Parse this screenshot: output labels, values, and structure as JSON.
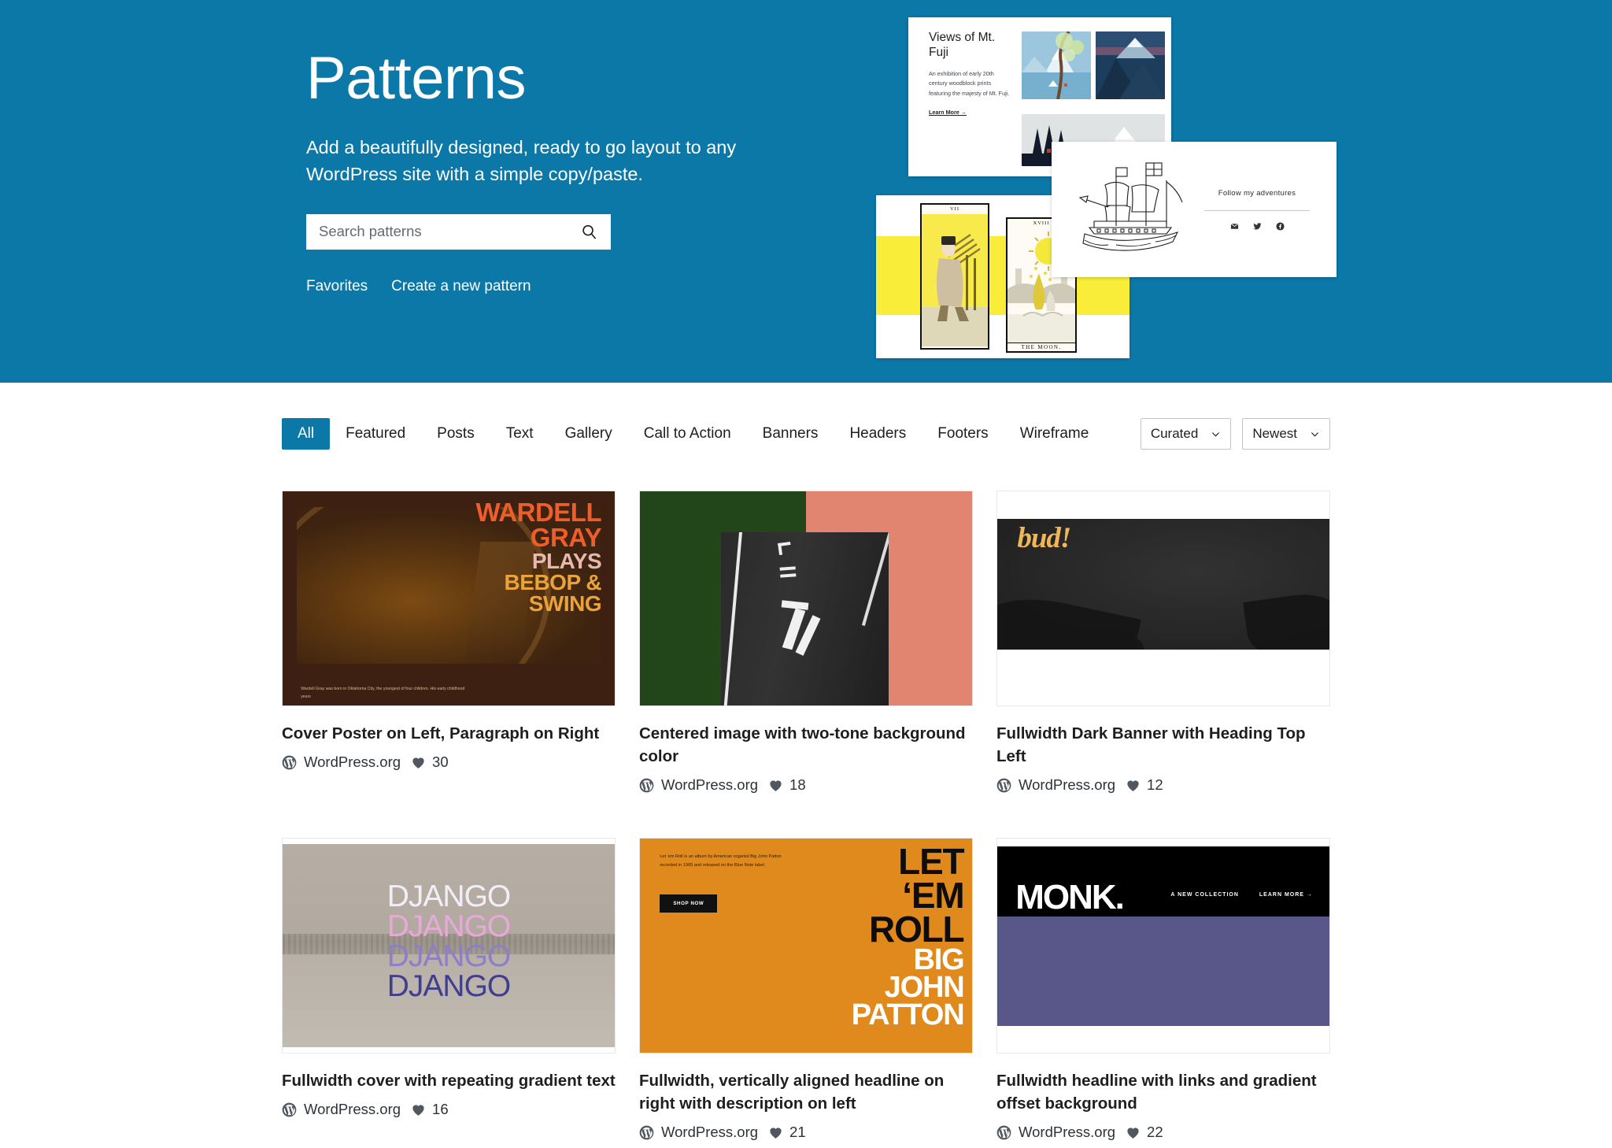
{
  "hero": {
    "title": "Patterns",
    "subtitle": "Add a beautifully designed, ready to go layout to any WordPress site with a simple copy/paste.",
    "search": {
      "value": "",
      "placeholder": "Search patterns",
      "icon": "search-icon",
      "button_label": "Search"
    },
    "links": [
      {
        "label": "Favorites"
      },
      {
        "label": "Create a new pattern"
      }
    ],
    "background_color": "#0b78a8",
    "mockups": {
      "fuji": {
        "heading": "Views of Mt. Fuji",
        "body": "An exhibition of early 20th century woodblock prints featuring the majesty of Mt. Fuji.",
        "link": "Learn More →"
      },
      "tarot": {
        "card_one_numeral": "VII",
        "card_two_numeral": "XVIII",
        "card_two_name": "THE MOON."
      },
      "ship": {
        "heading": "Follow my adventures",
        "icons": [
          "mail-icon",
          "twitter-icon",
          "facebook-icon"
        ]
      }
    }
  },
  "toolbar": {
    "tabs": [
      {
        "label": "All",
        "active": true
      },
      {
        "label": "Featured",
        "active": false
      },
      {
        "label": "Posts",
        "active": false
      },
      {
        "label": "Text",
        "active": false
      },
      {
        "label": "Gallery",
        "active": false
      },
      {
        "label": "Call to Action",
        "active": false
      },
      {
        "label": "Banners",
        "active": false
      },
      {
        "label": "Headers",
        "active": false
      },
      {
        "label": "Footers",
        "active": false
      },
      {
        "label": "Wireframe",
        "active": false
      }
    ],
    "selects": [
      {
        "name": "curation-select",
        "value": "Curated",
        "icon": "chevron-down-icon"
      },
      {
        "name": "sort-select",
        "value": "Newest",
        "icon": "chevron-down-icon"
      }
    ],
    "active_tab_color": "#0b78a8"
  },
  "patterns": [
    {
      "title": "Cover Poster on Left, Paragraph on Right",
      "author": "WordPress.org",
      "favorites": "30",
      "art": {
        "lines": [
          "WARDELL",
          "GRAY",
          "PLAYS",
          "BEBOP &",
          "SWING"
        ],
        "paragraph": "Wardell Gray was born in Oklahoma City, the youngest of four children. His early childhood years",
        "colors": {
          "background": "#3d2011",
          "accent": "#ef5d2a",
          "secondary": "#e8b8b0",
          "tertiary": "#e8a33c"
        }
      }
    },
    {
      "title": "Centered image with two-tone background color",
      "author": "WordPress.org",
      "favorites": "18",
      "art": {
        "colors": {
          "left": "#22461a",
          "right": "#e28570"
        }
      }
    },
    {
      "title": "Fullwidth Dark Banner with Heading Top Left",
      "author": "WordPress.org",
      "favorites": "12",
      "art": {
        "word": "bud!",
        "colors": {
          "background": "#262626",
          "accent": "#efb758"
        }
      }
    },
    {
      "title": "Fullwidth cover with repeating gradient text",
      "author": "WordPress.org",
      "favorites": "16",
      "art": {
        "lines": [
          "DJANGO",
          "DJANGO",
          "DJANGO",
          "DJANGO"
        ],
        "colors": {
          "line1": "#f2eef6",
          "line2": "#e7a9d6",
          "line3": "#8d7fc4",
          "line4": "#3f3f8e"
        }
      }
    },
    {
      "title": "Fullwidth, vertically aligned headline on right with description on left",
      "author": "WordPress.org",
      "favorites": "21",
      "art": {
        "paragraph": "Let 'em Roll is an album by American organist Big John Patton recorded in 1965 and released on the Blue Note label.",
        "button": "SHOP NOW",
        "lines": [
          "LET",
          "‘EM",
          "ROLL",
          "BIG",
          "JOHN",
          "PATTON"
        ],
        "colors": {
          "background": "#e08a1e",
          "dark": "#0d0d0d",
          "light": "#ffffff"
        }
      }
    },
    {
      "title": "Fullwidth headline with links and gradient offset background",
      "author": "WordPress.org",
      "favorites": "22",
      "art": {
        "word": "MONK.",
        "nav": [
          "A NEW COLLECTION",
          "LEARN MORE →"
        ],
        "colors": {
          "top": "#000000",
          "bottom": "#595789"
        }
      }
    }
  ],
  "icons": {
    "author": "wordpress-logo-icon",
    "favorite": "heart-icon"
  }
}
